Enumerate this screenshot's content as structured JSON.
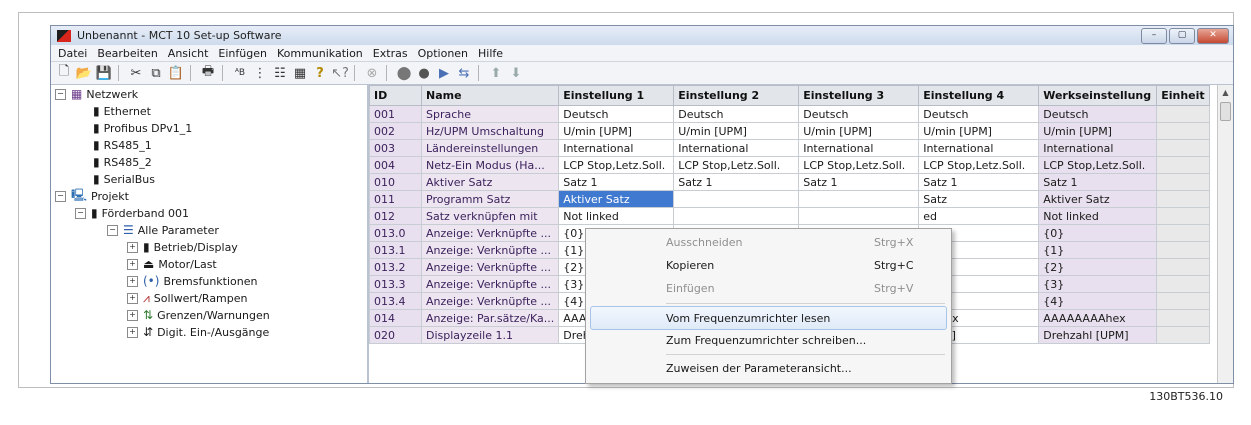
{
  "window": {
    "title": "Unbenannt - MCT 10 Set-up Software",
    "controls": [
      "–",
      "▢",
      "✕"
    ]
  },
  "menu": [
    "Datei",
    "Bearbeiten",
    "Ansicht",
    "Einfügen",
    "Kommunikation",
    "Extras",
    "Optionen",
    "Hilfe"
  ],
  "toolbar_icons": [
    "new-icon",
    "open-icon",
    "save-icon",
    "cut-icon",
    "copy-icon",
    "paste-icon",
    "print-icon",
    "sort-icon",
    "tree-icon",
    "list-icon",
    "grid-icon",
    "help-icon",
    "context-help-icon",
    "disabled-icon",
    "stop-icon",
    "record-icon",
    "read-drive-icon",
    "write-drive-icon",
    "up-arrow-icon",
    "down-arrow-icon"
  ],
  "tree": [
    {
      "label": "Netzwerk",
      "icon": "network-icon",
      "exp": "−"
    },
    {
      "label": "Ethernet",
      "icon": "bus-icon",
      "exp": ""
    },
    {
      "label": "Profibus DPv1_1",
      "icon": "bus-icon",
      "exp": ""
    },
    {
      "label": "RS485_1",
      "icon": "bus-icon",
      "exp": ""
    },
    {
      "label": "RS485_2",
      "icon": "bus-icon",
      "exp": ""
    },
    {
      "label": "SerialBus",
      "icon": "bus-icon",
      "exp": ""
    },
    {
      "label": "Projekt",
      "icon": "project-icon",
      "exp": "−"
    },
    {
      "label": "Förderband 001",
      "icon": "drive-icon",
      "exp": "−"
    },
    {
      "label": "Alle Parameter",
      "icon": "list-icon",
      "exp": "−"
    },
    {
      "label": "Betrieb/Display",
      "icon": "display-icon",
      "exp": "+"
    },
    {
      "label": "Motor/Last",
      "icon": "motor-icon",
      "exp": "+"
    },
    {
      "label": "Bremsfunktionen",
      "icon": "brake-icon",
      "exp": "+"
    },
    {
      "label": "Sollwert/Rampen",
      "icon": "ramp-icon",
      "exp": "+"
    },
    {
      "label": "Grenzen/Warnungen",
      "icon": "limits-icon",
      "exp": "+"
    },
    {
      "label": "Digit. Ein-/Ausgänge",
      "icon": "digital-io-icon",
      "exp": "+"
    }
  ],
  "table": {
    "headers": [
      "ID",
      "Name",
      "Einstellung 1",
      "Einstellung 2",
      "Einstellung 3",
      "Einstellung 4",
      "Werkseinstellung",
      "Einheit"
    ],
    "rows": [
      [
        "001",
        "Sprache",
        "Deutsch",
        "Deutsch",
        "Deutsch",
        "Deutsch",
        "Deutsch",
        ""
      ],
      [
        "002",
        "Hz/UPM Umschaltung",
        "U/min [UPM]",
        "U/min [UPM]",
        "U/min [UPM]",
        "U/min [UPM]",
        "U/min [UPM]",
        ""
      ],
      [
        "003",
        "Ländereinstellungen",
        "International",
        "International",
        "International",
        "International",
        "International",
        ""
      ],
      [
        "004",
        "Netz-Ein Modus (Ha...",
        "LCP Stop,Letz.Soll.",
        "LCP Stop,Letz.Soll.",
        "LCP Stop,Letz.Soll.",
        "LCP Stop,Letz.Soll.",
        "LCP Stop,Letz.Soll.",
        ""
      ],
      [
        "010",
        "Aktiver Satz",
        "Satz 1",
        "Satz 1",
        "Satz 1",
        "Satz 1",
        "Satz 1",
        ""
      ],
      [
        "011",
        "Programm Satz",
        "Aktiver Satz",
        "",
        "",
        "Satz",
        "Aktiver Satz",
        ""
      ],
      [
        "012",
        "Satz verknüpfen mit",
        "Not linked",
        "",
        "",
        "ed",
        "Not linked",
        ""
      ],
      [
        "013.0",
        "Anzeige: Verknüpfte ...",
        "{0}",
        "",
        "",
        "",
        "{0}",
        ""
      ],
      [
        "013.1",
        "Anzeige: Verknüpfte ...",
        "{1}",
        "",
        "",
        "",
        "{1}",
        ""
      ],
      [
        "013.2",
        "Anzeige: Verknüpfte ...",
        "{2}",
        "",
        "",
        "",
        "{2}",
        ""
      ],
      [
        "013.3",
        "Anzeige: Verknüpfte ...",
        "{3}",
        "",
        "",
        "",
        "{3}",
        ""
      ],
      [
        "013.4",
        "Anzeige: Verknüpfte ...",
        "{4}",
        "",
        "",
        "",
        "{4}",
        ""
      ],
      [
        "014",
        "Anzeige: Par.sätze/Ka...",
        "AAAAAAAAhex",
        "",
        "",
        "AAhex",
        "AAAAAAAAhex",
        ""
      ],
      [
        "020",
        "Displayzeile 1.1",
        "Drehzahl [UPM]",
        "",
        "",
        "[UPM]",
        "Drehzahl [UPM]",
        ""
      ]
    ]
  },
  "context_menu": [
    {
      "label": "Ausschneiden",
      "shortcut": "Strg+X",
      "enabled": false
    },
    {
      "label": "Kopieren",
      "shortcut": "Strg+C",
      "enabled": true
    },
    {
      "label": "Einfügen",
      "shortcut": "Strg+V",
      "enabled": false
    },
    {
      "label": "Vom Frequenzumrichter lesen",
      "shortcut": "",
      "enabled": true,
      "hover": true
    },
    {
      "label": "Zum Frequenzumrichter schreiben...",
      "shortcut": "",
      "enabled": true
    },
    {
      "label": "Zuweisen der Parameteransicht...",
      "shortcut": "",
      "enabled": true
    }
  ],
  "figure_id": "130BT536.10",
  "colors": {
    "selection": "#3f79d0",
    "id_column": "#e8e0ee",
    "name_text": "#3a1f5a"
  }
}
